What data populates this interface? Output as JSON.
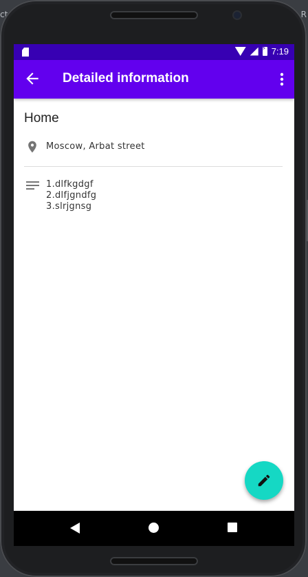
{
  "background": {
    "left_text": "ct",
    "right_text": "R"
  },
  "status_bar": {
    "time": "7:19",
    "icons": [
      "sd-card-icon",
      "wifi-icon",
      "signal-icon",
      "battery-charging-icon"
    ]
  },
  "app_bar": {
    "title": "Detailed information",
    "back_icon": "arrow-back-icon",
    "menu_icon": "overflow-menu-icon"
  },
  "details": {
    "title": "Home",
    "address": "Moscow, Arbat street",
    "notes": [
      "1.dlfkgdgf",
      "2.dlfjgndfg",
      "3.slrjgnsg"
    ]
  },
  "fab": {
    "icon": "edit-pencil-icon"
  },
  "colors": {
    "status_bar": "#3700b3",
    "app_bar": "#6200ee",
    "fab": "#15d8c4",
    "icon_gray": "#757575"
  }
}
